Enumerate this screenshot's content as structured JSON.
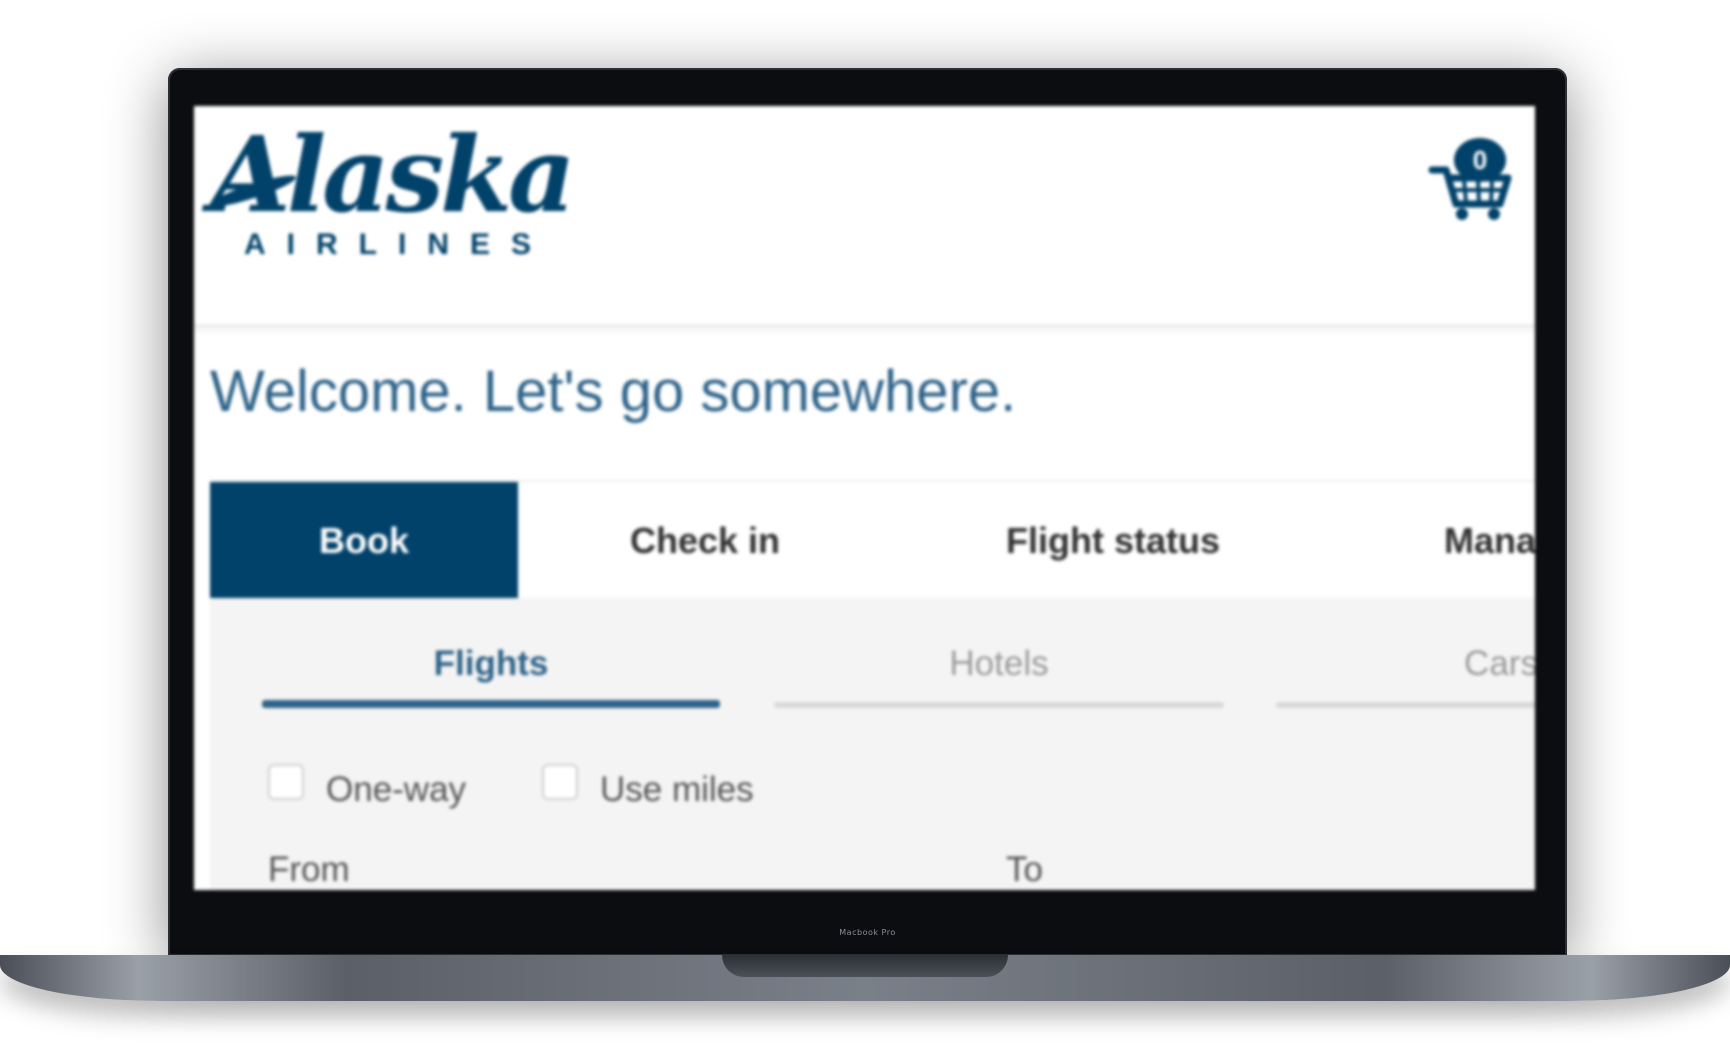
{
  "device": {
    "bezel_label": "Macbook Pro"
  },
  "brand": {
    "logo_script": "Alaska",
    "logo_sub": "AIRLINES",
    "primary_color": "#01426a",
    "accent_color": "#2e6389"
  },
  "header": {
    "cart_icon": "cart-icon",
    "cart_count": "0"
  },
  "welcome": {
    "title": "Welcome. Let's go somewhere."
  },
  "main_tabs": [
    {
      "label": "Book",
      "active": true
    },
    {
      "label": "Check in",
      "active": false
    },
    {
      "label": "Flight status",
      "active": false
    },
    {
      "label": "Manage trips",
      "active": false
    }
  ],
  "sub_tabs": [
    {
      "label": "Flights",
      "active": true
    },
    {
      "label": "Hotels",
      "active": false
    },
    {
      "label": "Cars",
      "active": false
    }
  ],
  "options": {
    "one_way": {
      "label": "One-way",
      "checked": false
    },
    "use_miles": {
      "label": "Use miles",
      "checked": false
    }
  },
  "fields": {
    "from_label": "From",
    "to_label": "To"
  }
}
